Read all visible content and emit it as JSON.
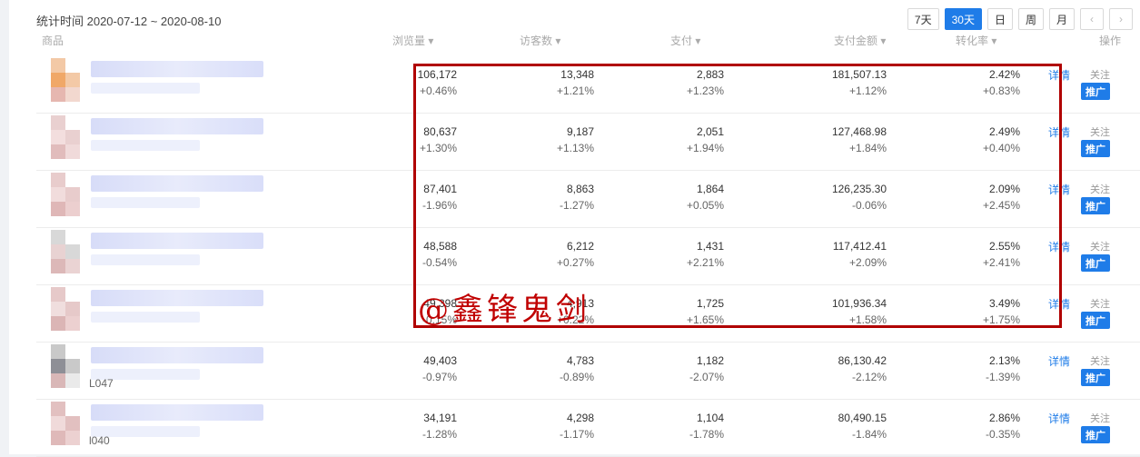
{
  "topbar": {
    "date_range": "统计时间 2020-07-12 ~ 2020-08-10",
    "periods": [
      "7天",
      "30天",
      "日",
      "周",
      "月"
    ],
    "active_period": "30天",
    "prev_icon": "‹",
    "next_icon": "›"
  },
  "actions": {
    "detail": "详情",
    "follow": "关注",
    "promote": "推广"
  },
  "rows": [
    {
      "sku": "",
      "c1": "106,172",
      "d1": "+0.46%",
      "c2": "13,348",
      "d2": "+1.21%",
      "c3": "2,883",
      "d3": "+1.23%",
      "c4": "181,507.13",
      "d4": "+1.12%",
      "c5": "2.42%",
      "d5": "+0.83%"
    },
    {
      "sku": "",
      "c1": "80,637",
      "d1": "+1.30%",
      "c2": "9,187",
      "d2": "+1.13%",
      "c3": "2,051",
      "d3": "+1.94%",
      "c4": "127,468.98",
      "d4": "+1.84%",
      "c5": "2.49%",
      "d5": "+0.40%"
    },
    {
      "sku": "",
      "c1": "87,401",
      "d1": "-1.96%",
      "c2": "8,863",
      "d2": "-1.27%",
      "c3": "1,864",
      "d3": "+0.05%",
      "c4": "126,235.30",
      "d4": "-0.06%",
      "c5": "2.09%",
      "d5": "+2.45%"
    },
    {
      "sku": "",
      "c1": "48,588",
      "d1": "-0.54%",
      "c2": "6,212",
      "d2": "+0.27%",
      "c3": "1,431",
      "d3": "+2.21%",
      "c4": "117,412.41",
      "d4": "+2.09%",
      "c5": "2.55%",
      "d5": "+2.41%"
    },
    {
      "sku": "",
      "c1": "49,398",
      "d1": "-0.15%",
      "c2": "4,913",
      "d2": "+0.22%",
      "c3": "1,725",
      "d3": "+1.65%",
      "c4": "101,936.34",
      "d4": "+1.58%",
      "c5": "3.49%",
      "d5": "+1.75%"
    },
    {
      "sku": "L047",
      "c1": "49,403",
      "d1": "-0.97%",
      "c2": "4,783",
      "d2": "-0.89%",
      "c3": "1,182",
      "d3": "-2.07%",
      "c4": "86,130.42",
      "d4": "-2.12%",
      "c5": "2.13%",
      "d5": "-1.39%"
    },
    {
      "sku": "l040",
      "c1": "34,191",
      "d1": "-1.28%",
      "c2": "4,298",
      "d2": "-1.17%",
      "c3": "1,104",
      "d3": "-1.78%",
      "c4": "80,490.15",
      "d4": "-1.84%",
      "c5": "2.86%",
      "d5": "-0.35%"
    }
  ],
  "watermark": "@鑫锋鬼剑",
  "colors": {
    "accent": "#1f7ce8",
    "highlight_box": "#b00000"
  }
}
